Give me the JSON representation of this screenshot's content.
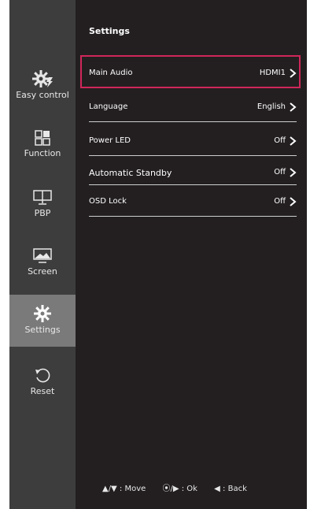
{
  "page_title": "Settings",
  "sidebar": {
    "items": [
      {
        "label": "Easy control",
        "icon": "gear-bolt-icon",
        "selected": false
      },
      {
        "label": "Function",
        "icon": "grid-icon",
        "selected": false
      },
      {
        "label": "PBP",
        "icon": "dual-monitor-icon",
        "selected": false
      },
      {
        "label": "Screen",
        "icon": "screen-icon",
        "selected": false
      },
      {
        "label": "Settings",
        "icon": "gear-icon",
        "selected": true
      },
      {
        "label": "Reset",
        "icon": "reset-icon",
        "selected": false
      }
    ]
  },
  "settings": {
    "items": [
      {
        "label": "Main Audio",
        "value": "HDMI1",
        "highlighted": true
      },
      {
        "label": "Language",
        "value": "English",
        "highlighted": false
      },
      {
        "label": "Power LED",
        "value": "Off",
        "highlighted": false
      },
      {
        "label": "Automatic Standby",
        "value": "Off",
        "highlighted": false
      },
      {
        "label": "OSD Lock",
        "value": "Off",
        "highlighted": false
      }
    ]
  },
  "footer": {
    "move_keys": "▲/▼",
    "move_label": "Move",
    "ok_keys": "⦿/▶",
    "ok_label": "Ok",
    "back_key": "◀",
    "back_label": "Back"
  },
  "colors": {
    "sidebar_bg": "#3d3d3d",
    "selected_bg": "#7a7a7a",
    "panel_bg": "#231f20",
    "highlight": "#d0275a"
  }
}
